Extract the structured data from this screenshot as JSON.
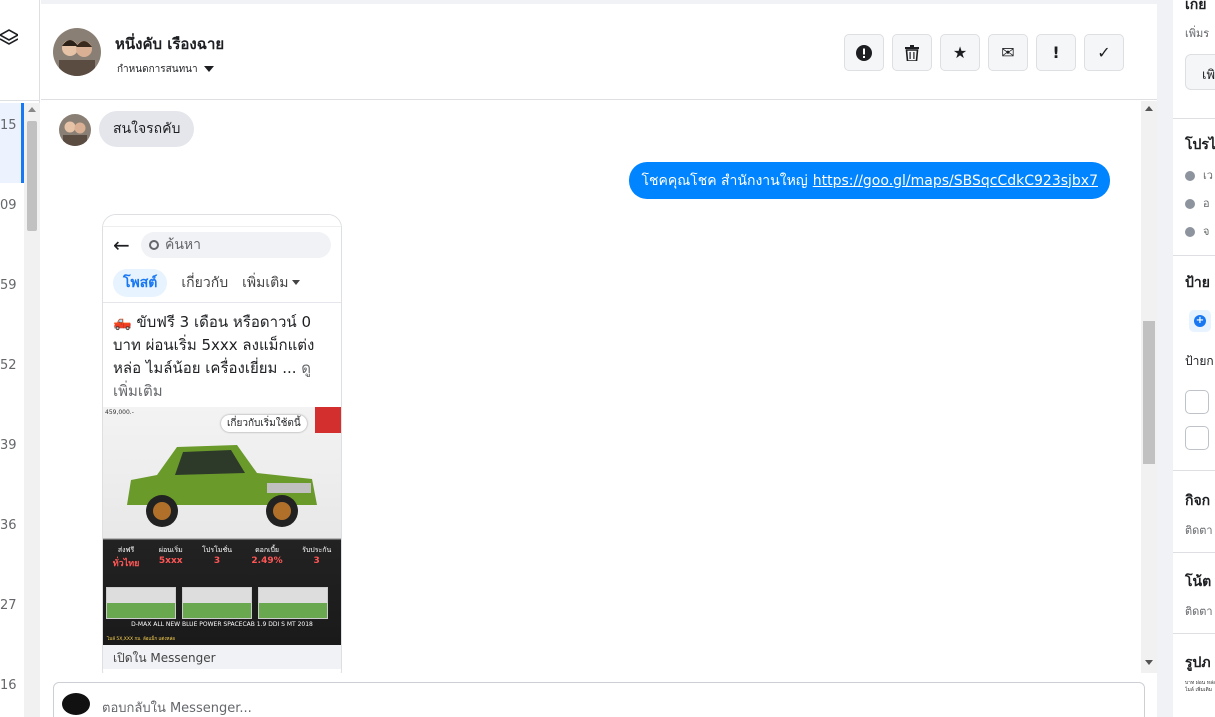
{
  "conversation_list": {
    "counts": [
      "15",
      "09",
      "59",
      "52",
      "39",
      "36",
      "27",
      "16"
    ]
  },
  "header": {
    "contact_name": "หนึ่งคับ เรืองฉาย",
    "assign_label": "กำหนดการสนทนา",
    "actions": [
      {
        "icon": "alert-circle-icon",
        "glyph": "!"
      },
      {
        "icon": "trash-icon",
        "glyph": ""
      },
      {
        "icon": "star-icon",
        "glyph": "★"
      },
      {
        "icon": "envelope-icon",
        "glyph": "✉"
      },
      {
        "icon": "exclamation-icon",
        "glyph": "!"
      },
      {
        "icon": "checkmark-icon",
        "glyph": "✓"
      }
    ]
  },
  "messages": {
    "incoming_1": "สนใจรถคับ",
    "outgoing_1_text": "โชคคุณโชค สำนักงานใหญ่",
    "outgoing_1_link": "https://goo.gl/maps/SBSqcCdkC923sjbx7",
    "shared_post": {
      "search_placeholder": "ค้นหา",
      "tabs": [
        "โพสต์",
        "เกี่ยวกับ",
        "เพิ่มเติม"
      ],
      "text": "🛻 ขับฟรี 3 เดือน หรือดาวน์ 0 บาท ผ่อนเริ่ม 5xxx  ลงแม็กแต่ง หล่อ ไมล์น้อย เครื่องเยี่ยม ...",
      "see_more": "ดูเพิ่มเติม",
      "image_tag": "เกี่ยวกับเริ่มใช้ตนี้",
      "image_header": "459,000.-",
      "image_stats": [
        {
          "label": "ส่งฟรี",
          "value": "ทั่วไทย"
        },
        {
          "label": "ผ่อนเริ่ม",
          "value": "5xxx"
        },
        {
          "label": "โปรโมชั่น",
          "value": "3"
        },
        {
          "label": "ดอกเบี้ย",
          "value": "2.49%"
        },
        {
          "label": "รับประกัน",
          "value": "3"
        }
      ],
      "image_model": "D-MAX ALL NEW BLUE POWER SPACECAB 1.9 DDI S MT 2018",
      "image_contact": "ไมล์ 5X,XXX กม. ล้อแม็ก แต่งหล่อ",
      "footer": "เปิดใน Messenger"
    }
  },
  "composer": {
    "placeholder": "ตอบกลับใน Messenger..."
  },
  "right_panel": {
    "top_title": "เกย",
    "top_sub": "เพิ่มร",
    "top_button": "เพิ",
    "profile_title": "โปรไ",
    "profile_rows": [
      "เว",
      "อ",
      "จ"
    ],
    "labels_title": "ป้าย",
    "labels_sub": "ป้ายก",
    "activity_title": "กิจก",
    "activity_sub": "ติดตา",
    "notes_title": "โน้ต",
    "notes_sub": "ติดตา",
    "photos_title": "รูปภ",
    "photo_thumb_text": "บาท ผ่อน หล่อ ไมล์ เพิ่มเติม"
  },
  "colors": {
    "accent": "#1877f2",
    "outgoing_bubble": "#0084ff",
    "incoming_bubble": "#e4e6eb",
    "border": "#dddfe2"
  }
}
